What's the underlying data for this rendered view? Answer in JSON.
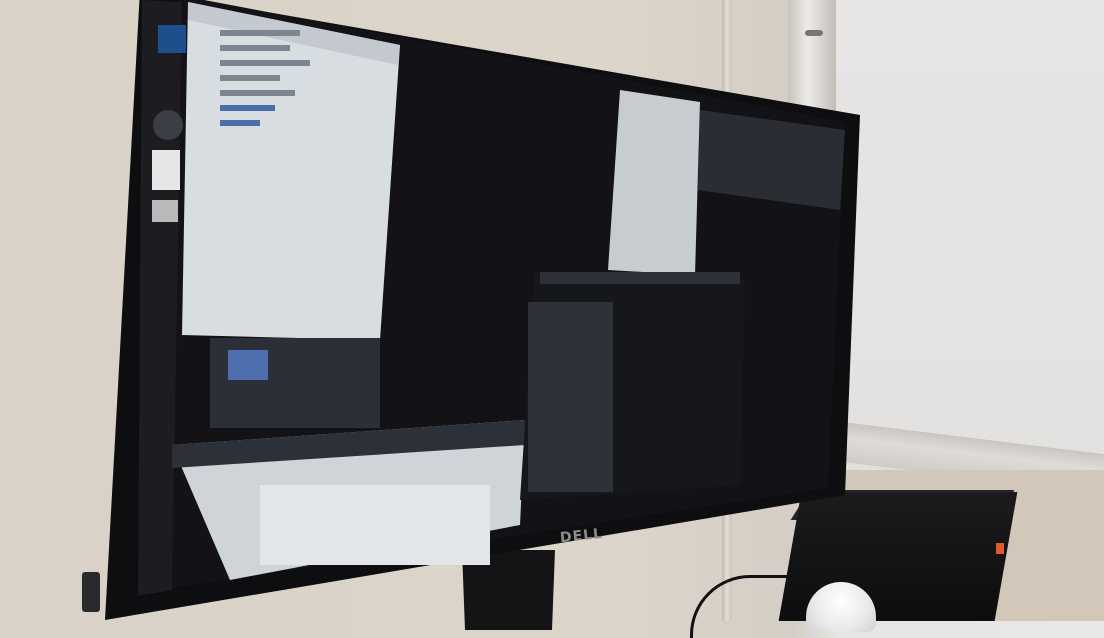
{
  "scene": {
    "description_tags": [
      "monitor",
      "desktop",
      "office"
    ],
    "monitor_brand": "DELL",
    "colors": {
      "bezel": "#0e0e10",
      "screen_dark": "#141417",
      "window_light": "#d8dde2",
      "wall": "#d9d2c7",
      "pc_led": "#e05a2b"
    }
  }
}
